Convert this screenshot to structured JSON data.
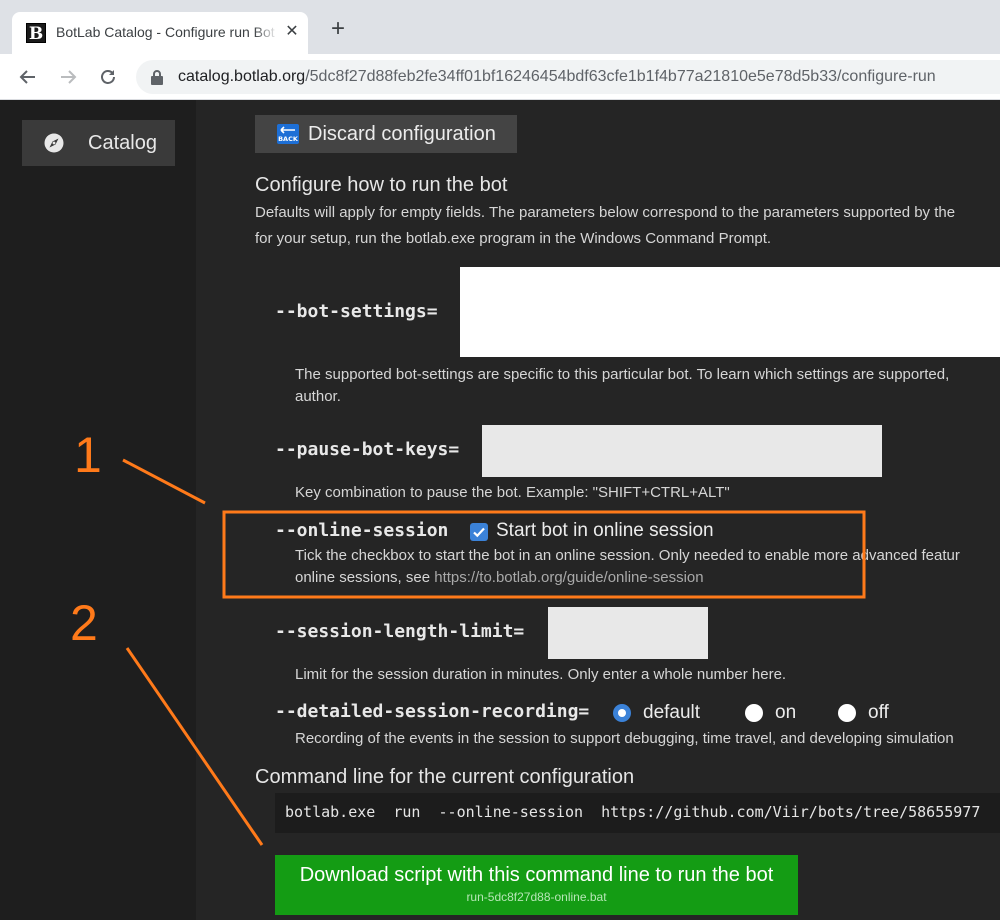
{
  "browser": {
    "tab_title": "BotLab Catalog - Configure run Bot",
    "favicon_letter": "B",
    "close_glyph": "✕",
    "new_tab_glyph": "+",
    "url_host": "catalog.botlab.org",
    "url_path": "/5dc8f27d88feb2fe34ff01bf16246454bdf63cfe1b1f4b77a21810e5e78d5b33/configure-run"
  },
  "sidebar": {
    "catalog_label": "Catalog",
    "catalog_icon": "compass-icon"
  },
  "main": {
    "discard_label": "Discard configuration",
    "discard_icon": "back-icon",
    "config_title": "Configure how to run the bot",
    "config_desc_line1": "Defaults will apply for empty fields. The parameters below correspond to the parameters supported by the",
    "config_desc_line2": "for your setup, run the botlab.exe program in the Windows Command Prompt.",
    "params": {
      "bot_settings": {
        "label": "--bot-settings=",
        "value": "",
        "help_line1": "The supported bot-settings are specific to this particular bot. To learn which settings are supported,",
        "help_line2": "author."
      },
      "pause_bot_keys": {
        "label": "--pause-bot-keys=",
        "value": "",
        "help": "Key combination to pause the bot. Example: \"SHIFT+CTRL+ALT\""
      },
      "online_session": {
        "label": "--online-session",
        "checkbox_label": "Start bot in online session",
        "checked": true,
        "help_line1": "Tick the checkbox to start the bot in an online session. Only needed to enable more advanced featur",
        "help_line2_prefix": "online sessions, see ",
        "help_link": "https://to.botlab.org/guide/online-session"
      },
      "session_length_limit": {
        "label": "--session-length-limit=",
        "value": "",
        "help": "Limit for the session duration in minutes. Only enter a whole number here."
      },
      "detailed_session_recording": {
        "label": "--detailed-session-recording=",
        "options": [
          "default",
          "on",
          "off"
        ],
        "selected": "default",
        "help": "Recording of the events in the session to support debugging, time travel, and developing simulation"
      }
    },
    "command_title": "Command line for the current configuration",
    "command_line": "botlab.exe  run  --online-session  https://github.com/Viir/bots/tree/58655977",
    "download_label": "Download script with this command line to run the bot",
    "download_filename": "run-5dc8f27d88-online.bat"
  },
  "annotations": {
    "color": "#ff7a1a",
    "labels": [
      "1",
      "2"
    ]
  }
}
